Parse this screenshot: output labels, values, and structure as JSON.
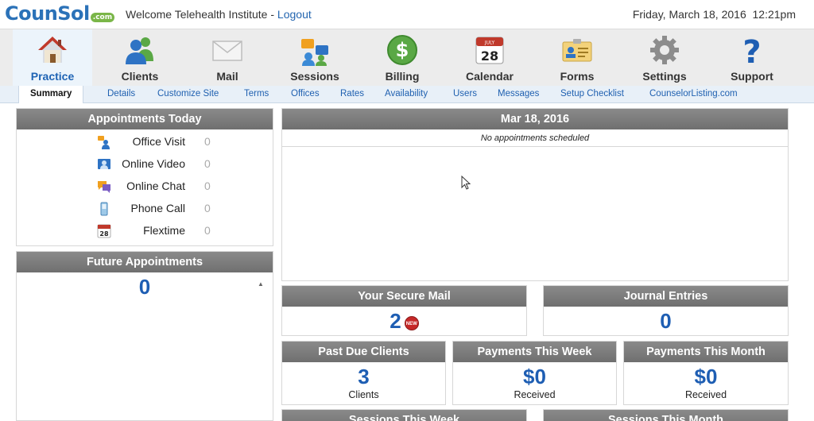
{
  "header": {
    "logo_text": "CounSol",
    "logo_suffix": ".com",
    "welcome": "Welcome Telehealth Institute - ",
    "logout": "Logout",
    "datetime": "Friday, March 18, 2016  12:21pm"
  },
  "nav": [
    {
      "label": "Practice",
      "icon": "house-icon"
    },
    {
      "label": "Clients",
      "icon": "people-icon"
    },
    {
      "label": "Mail",
      "icon": "envelope-icon"
    },
    {
      "label": "Sessions",
      "icon": "sessions-icon"
    },
    {
      "label": "Billing",
      "icon": "dollar-icon"
    },
    {
      "label": "Calendar",
      "icon": "calendar-icon",
      "calendar_month": "JULY",
      "calendar_day": "28"
    },
    {
      "label": "Forms",
      "icon": "id-card-icon"
    },
    {
      "label": "Settings",
      "icon": "gear-icon"
    },
    {
      "label": "Support",
      "icon": "question-icon"
    }
  ],
  "subnav": [
    "Summary",
    "Details",
    "Customize Site",
    "Terms",
    "Offices",
    "Rates",
    "Availability",
    "Users",
    "Messages",
    "Setup Checklist",
    "CounselorListing.com"
  ],
  "appointments_today": {
    "title": "Appointments Today",
    "rows": [
      {
        "label": "Office Visit",
        "count": "0",
        "icon": "office-visit-icon"
      },
      {
        "label": "Online Video",
        "count": "0",
        "icon": "video-icon"
      },
      {
        "label": "Online Chat",
        "count": "0",
        "icon": "chat-icon"
      },
      {
        "label": "Phone Call",
        "count": "0",
        "icon": "phone-icon"
      },
      {
        "label": "Flextime",
        "count": "0",
        "icon": "calendar-icon",
        "calendar_day": "28"
      }
    ]
  },
  "future_appointments": {
    "title": "Future Appointments",
    "value": "0"
  },
  "day_panel": {
    "title": "Mar 18, 2016",
    "message": "No appointments scheduled"
  },
  "secure_mail": {
    "title": "Your Secure Mail",
    "value": "2",
    "badge": "NEW"
  },
  "journal": {
    "title": "Journal Entries",
    "value": "0"
  },
  "past_due": {
    "title": "Past Due Clients",
    "value": "3",
    "sub": "Clients"
  },
  "payments_week": {
    "title": "Payments This Week",
    "value": "$0",
    "sub": "Received"
  },
  "payments_month": {
    "title": "Payments This Month",
    "value": "$0",
    "sub": "Received"
  },
  "sessions_week": {
    "title": "Sessions This Week"
  },
  "sessions_month": {
    "title": "Sessions This Month"
  },
  "colors": {
    "brand_blue": "#2b72b8",
    "header_gray": "#777777",
    "link_blue": "#1f60b0",
    "badge_red": "#c62828"
  }
}
